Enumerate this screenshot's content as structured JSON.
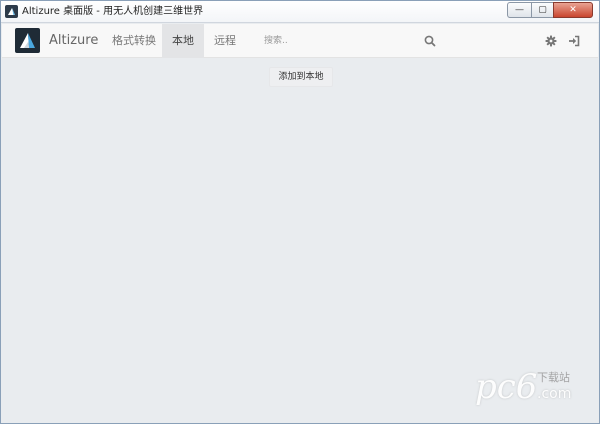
{
  "window": {
    "title": "Altizure 桌面版 - 用无人机创建三维世界",
    "minimize_label": "—",
    "maximize_label": "▢",
    "close_label": "✕"
  },
  "navbar": {
    "brand": "Altizure",
    "items": [
      {
        "label": "格式转换",
        "active": false
      },
      {
        "label": "本地",
        "active": true
      },
      {
        "label": "远程",
        "active": false
      }
    ],
    "search_placeholder": "搜索..",
    "icons": [
      "search-icon",
      "gear-icon",
      "sign-in-icon"
    ]
  },
  "main": {
    "add_local_label": "添加到本地"
  },
  "watermark": {
    "logo_text": "pc6",
    "download_text": "下载站",
    "domain_text": ".com"
  },
  "colors": {
    "navbar_bg": "#f8f8f8",
    "active_tab_bg": "#e3e4e6",
    "content_bg": "#e9ecef",
    "close_button": "#c9452f"
  }
}
